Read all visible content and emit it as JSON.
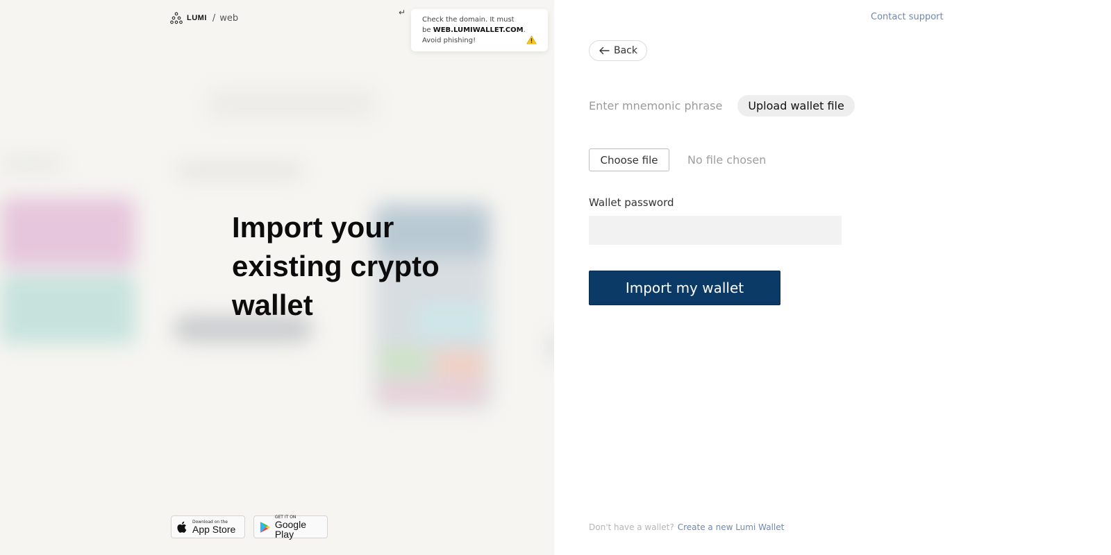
{
  "brand": {
    "name": "LUMI",
    "separator": "/",
    "sub": "web"
  },
  "warning": {
    "line1": "Check the domain. It must",
    "prefix": "be ",
    "domain": "WEB.LUMIWALLET.COM",
    "suffix": ".",
    "line3": "Avoid phishing!",
    "icon": "warning-icon"
  },
  "headline": {
    "line1": "Import your",
    "line2": "existing crypto",
    "line3": "wallet"
  },
  "stores": {
    "app_store": {
      "small": "Download on the",
      "big": "App Store"
    },
    "google_play": {
      "small": "GET IT ON",
      "big": "Google Play"
    }
  },
  "header": {
    "contact_support": "Contact support"
  },
  "back": {
    "label": "Back"
  },
  "tabs": [
    {
      "label": "Enter mnemonic phrase",
      "active": false
    },
    {
      "label": "Upload wallet file",
      "active": true
    }
  ],
  "file": {
    "choose_label": "Choose file",
    "status": "No file chosen"
  },
  "password": {
    "label": "Wallet password",
    "value": ""
  },
  "submit": {
    "label": "Import my wallet"
  },
  "footer": {
    "question": "Don't have a wallet?",
    "link": "Create a new Lumi Wallet"
  },
  "colors": {
    "primary": "#0c3a66",
    "link": "#6f87b5",
    "left_bg": "#f6f5f1",
    "warning": "#f5c518"
  }
}
